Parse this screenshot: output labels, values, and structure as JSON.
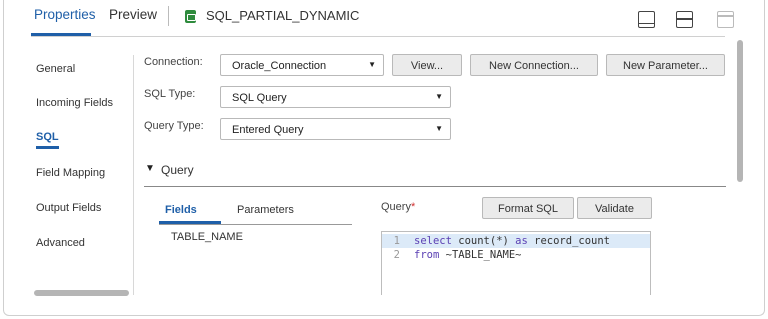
{
  "header": {
    "tabs": [
      {
        "label": "Properties",
        "active": true
      },
      {
        "label": "Preview",
        "active": false
      }
    ],
    "object_title": "SQL_PARTIAL_DYNAMIC",
    "object_icon": "sql-object-icon",
    "layout_icons": [
      "layout-bottom-panel-icon",
      "layout-split-icon",
      "layout-top-panel-icon"
    ]
  },
  "nav": {
    "items": [
      {
        "label": "General",
        "active": false
      },
      {
        "label": "Incoming Fields",
        "active": false
      },
      {
        "label": "SQL",
        "active": true
      },
      {
        "label": "Field Mapping",
        "active": false
      },
      {
        "label": "Output Fields",
        "active": false
      },
      {
        "label": "Advanced",
        "active": false
      }
    ]
  },
  "form": {
    "connection": {
      "label": "Connection:",
      "value": "Oracle_Connection",
      "buttons": [
        "View...",
        "New Connection...",
        "New Parameter..."
      ]
    },
    "sql_type": {
      "label": "SQL Type:",
      "value": "SQL Query"
    },
    "query_type": {
      "label": "Query Type:",
      "value": "Entered Query"
    }
  },
  "query_section": {
    "title": "Query",
    "tabs": [
      "Fields",
      "Parameters"
    ],
    "fields": [
      "TABLE_NAME"
    ],
    "query_label": "Query",
    "required_mark": "*",
    "buttons": {
      "format": "Format SQL",
      "validate": "Validate"
    },
    "code_lines": [
      {
        "number": "1",
        "parts": [
          {
            "t": "select",
            "kw": true
          },
          {
            "t": " count(*) ",
            "kw": false
          },
          {
            "t": "as",
            "kw": true
          },
          {
            "t": " record_count",
            "kw": false
          }
        ]
      },
      {
        "number": "2",
        "parts": [
          {
            "t": "from",
            "kw": true
          },
          {
            "t": " ~TABLE_NAME~",
            "kw": false
          }
        ]
      }
    ]
  },
  "colors": {
    "accent": "#1f5fa8",
    "required": "#d03030",
    "keyword": "#5a3fb3",
    "active_line": "#dceaf8"
  }
}
